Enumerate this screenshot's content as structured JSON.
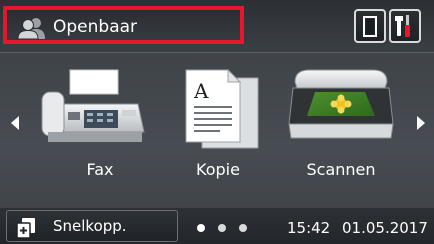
{
  "header": {
    "user_label": "Openbaar",
    "user_icon": "users-icon",
    "highlight_color": "#e6172d",
    "cartridge_icon": "toner-cartridge-icon",
    "settings_icon": "tools-icon"
  },
  "functions": [
    {
      "label": "Fax",
      "icon": "fax-icon"
    },
    {
      "label": "Kopie",
      "icon": "copy-icon"
    },
    {
      "label": "Scannen",
      "icon": "scanner-icon"
    }
  ],
  "footer": {
    "shortcut_label": "Snelkopp.",
    "shortcut_icon": "shortcuts-icon",
    "page_count": 3,
    "current_page": 1,
    "time": "15:42",
    "date": "01.05.2017"
  }
}
